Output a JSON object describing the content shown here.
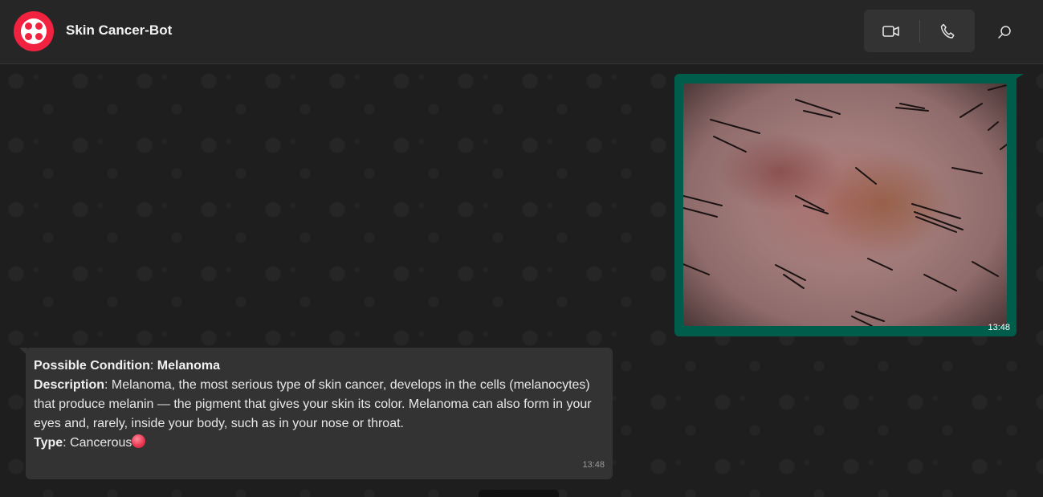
{
  "header": {
    "title": "Skin Cancer-Bot",
    "avatar_icon": "twilio-logo-icon",
    "video_icon": "video-camera-icon",
    "call_icon": "phone-icon",
    "search_icon": "search-icon"
  },
  "colors": {
    "accent_red": "#f0223f",
    "outgoing_bubble": "#005c4b",
    "incoming_bubble": "#333333",
    "header_bg": "#262626"
  },
  "messages": {
    "image_message": {
      "time": "13:48"
    },
    "bot_reply": {
      "condition_label": "Possible Condition",
      "condition_sep": ": ",
      "condition_value": "Melanoma",
      "description_label": "Description",
      "description_sep": ": ",
      "description_text": "Melanoma, the most serious type of skin cancer, develops in the cells (melanocytes) that produce melanin — the pigment that gives your skin its color. Melanoma can also form in your eyes and, rarely, inside your body, such as in your nose or throat.",
      "type_label": "Type",
      "type_sep": ": ",
      "type_value": "Cancerous",
      "type_icon": "red-circle-icon",
      "time": "13:48"
    }
  }
}
